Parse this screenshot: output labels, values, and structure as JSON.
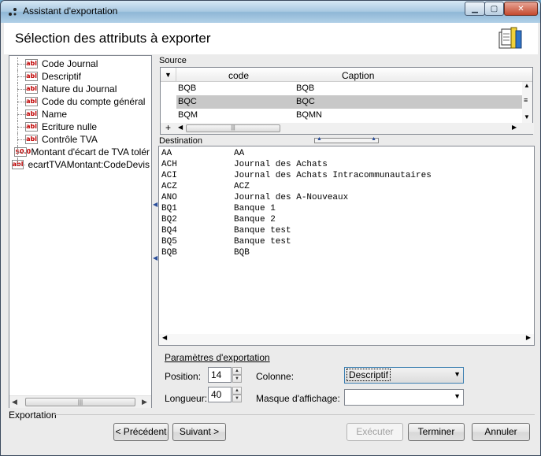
{
  "window": {
    "title": "Assistant d'exportation"
  },
  "header": {
    "title": "Sélection des attributs à exporter",
    "icon": "export-wizard-icon"
  },
  "tree": {
    "items": [
      {
        "icon_text": "abl",
        "label": "Code Journal"
      },
      {
        "icon_text": "abl",
        "label": "Descriptif"
      },
      {
        "icon_text": "abl",
        "label": "Nature du Journal"
      },
      {
        "icon_text": "abl",
        "label": "Code du compte général"
      },
      {
        "icon_text": "abl",
        "label": "Name"
      },
      {
        "icon_text": "abl",
        "label": "Ecriture nulle"
      },
      {
        "icon_text": "abl",
        "label": "Contrôle TVA"
      },
      {
        "icon_text": "$0.0",
        "label": "Montant d'écart de TVA tolér"
      },
      {
        "icon_text": "abl",
        "label": "ecartTVAMontant:CodeDevis"
      }
    ]
  },
  "source": {
    "label": "Source",
    "columns": [
      "code",
      "Caption"
    ],
    "rows": [
      {
        "code": "BQB",
        "caption": "BQB",
        "selected": false
      },
      {
        "code": "BQC",
        "caption": "BQC",
        "selected": true
      },
      {
        "code": "BQM",
        "caption": "BQMN",
        "selected": false
      }
    ],
    "add_symbol": "+"
  },
  "destination": {
    "label": "Destination",
    "lines": [
      {
        "code": "AA",
        "text": "AA"
      },
      {
        "code": "ACH",
        "text": "Journal des Achats"
      },
      {
        "code": "ACI",
        "text": "Journal des Achats Intracommunautaires"
      },
      {
        "code": "ACZ",
        "text": "ACZ"
      },
      {
        "code": "ANO",
        "text": "Journal des A-Nouveaux"
      },
      {
        "code": "BQ1",
        "text": "Banque 1"
      },
      {
        "code": "BQ2",
        "text": "Banque 2"
      },
      {
        "code": "BQ4",
        "text": "Banque test"
      },
      {
        "code": "BQ5",
        "text": "Banque test"
      },
      {
        "code": "BQB",
        "text": "BQB"
      }
    ]
  },
  "params": {
    "title": "Paramètres d'exportation",
    "position_label": "Position:",
    "position_value": "14",
    "length_label": "Longueur:",
    "length_value": "40",
    "column_label": "Colonne:",
    "column_value": "Descriptif",
    "mask_label": "Masque d'affichage:",
    "mask_value": ""
  },
  "footer": {
    "group_label": "Exportation",
    "prev": "< Précédent",
    "next": "Suivant >",
    "execute": "Exécuter",
    "finish": "Terminer",
    "cancel": "Annuler"
  }
}
